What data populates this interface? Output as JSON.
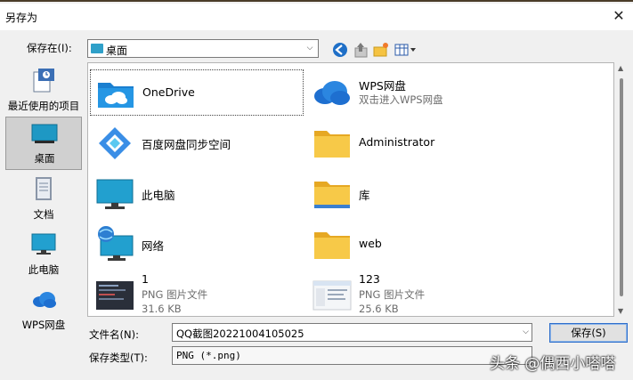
{
  "window": {
    "title": "另存为"
  },
  "header": {
    "save_in_label": "保存在(I):",
    "save_in_value": "桌面"
  },
  "toolbar": {
    "icons": [
      "back-icon",
      "up-folder-icon",
      "new-folder-icon",
      "view-menu-icon"
    ]
  },
  "places": [
    {
      "label": "最近使用的项目",
      "icon": "recent-icon"
    },
    {
      "label": "桌面",
      "icon": "desktop-icon",
      "selected": true
    },
    {
      "label": "文档",
      "icon": "documents-icon"
    },
    {
      "label": "此电脑",
      "icon": "computer-icon"
    },
    {
      "label": "WPS网盘",
      "icon": "cloud-icon"
    }
  ],
  "items": [
    {
      "name": "OneDrive",
      "icon": "onedrive-icon"
    },
    {
      "name": "WPS网盘",
      "sub": "双击进入WPS网盘",
      "icon": "wps-cloud-icon"
    },
    {
      "name": "百度网盘同步空间",
      "icon": "baidu-icon"
    },
    {
      "name": "Administrator",
      "icon": "folder-icon"
    },
    {
      "name": "此电脑",
      "icon": "computer-icon"
    },
    {
      "name": "库",
      "icon": "library-folder-icon"
    },
    {
      "name": "网络",
      "icon": "network-icon"
    },
    {
      "name": "web",
      "icon": "folder-icon"
    },
    {
      "name": "1",
      "type": "PNG 图片文件",
      "size": "31.6 KB",
      "icon": "png-thumbnail-icon"
    },
    {
      "name": "123",
      "type": "PNG 图片文件",
      "size": "25.6 KB",
      "icon": "png-thumbnail-icon"
    }
  ],
  "footer": {
    "filename_label": "文件名(N):",
    "filename_value": "QQ截图20221004105025",
    "filetype_label": "保存类型(T):",
    "filetype_value": "PNG (*.png)",
    "save_button": "保存(S)"
  },
  "watermark": "头条 @偶西小嗒嗒",
  "colors": {
    "accent": "#2f6fcb",
    "folder": "#f5c342",
    "cloud": "#1e6fd0"
  }
}
